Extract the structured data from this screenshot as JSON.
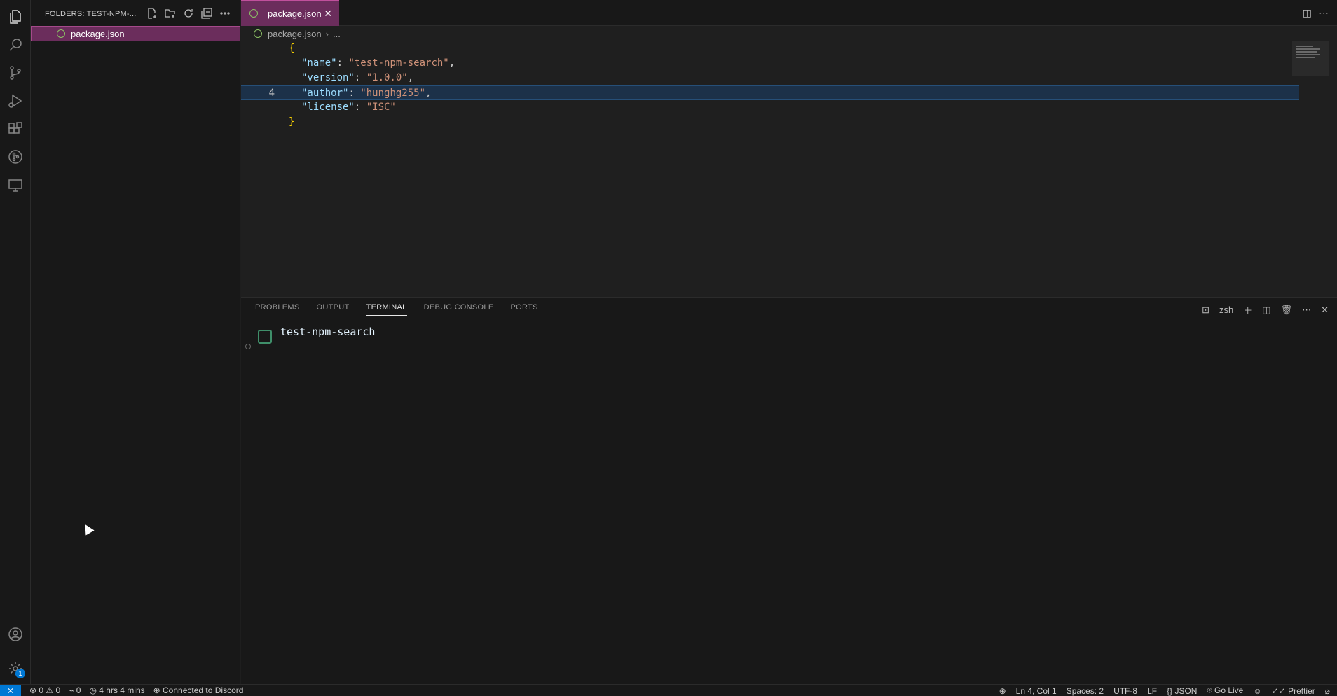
{
  "activity_bar": {
    "icons": [
      "explorer-icon",
      "search-icon",
      "source-control-icon",
      "run-debug-icon",
      "extensions-icon",
      "git-graph-icon",
      "remote-explorer-icon"
    ],
    "account_icon": "account-icon",
    "settings_icon": "settings-icon",
    "settings_badge": "1"
  },
  "sidebar": {
    "title": "FOLDERS: TEST-NPM-...",
    "actions": [
      "new-file-icon",
      "new-folder-icon",
      "refresh-icon",
      "collapse-all-icon",
      "more-icon"
    ],
    "files": [
      {
        "name": "package.json"
      }
    ]
  },
  "editor": {
    "tab_label": "package.json",
    "tab_close": "✕",
    "breadcrumb_file": "package.json",
    "breadcrumb_more": "...",
    "current_line_number": "4",
    "lines": [
      {
        "text_open": "{"
      },
      {
        "key": "\"name\"",
        "colon": ": ",
        "value": "\"test-npm-search\"",
        "comma": ","
      },
      {
        "key": "\"version\"",
        "colon": ": ",
        "value": "\"1.0.0\"",
        "comma": ","
      },
      {
        "key": "\"author\"",
        "colon": ": ",
        "value": "\"hunghg255\"",
        "comma": ","
      },
      {
        "key": "\"license\"",
        "colon": ": ",
        "value": "\"ISC\"",
        "comma": ""
      },
      {
        "text_close": "}"
      }
    ]
  },
  "panel": {
    "tabs": [
      "PROBLEMS",
      "OUTPUT",
      "TERMINAL",
      "DEBUG CONSOLE",
      "PORTS"
    ],
    "active_tab": "TERMINAL",
    "shell": "zsh",
    "terminal_text": "test-npm-search"
  },
  "statusbar": {
    "errors": "0",
    "warnings": "0",
    "ports": "0",
    "time": "4 hrs 4 mins",
    "discord": "Connected to Discord",
    "position": "Ln 4, Col 1",
    "spaces": "Spaces: 2",
    "encoding": "UTF-8",
    "eol": "LF",
    "language": "JSON",
    "golive": "Go Live",
    "prettier": "Prettier"
  }
}
